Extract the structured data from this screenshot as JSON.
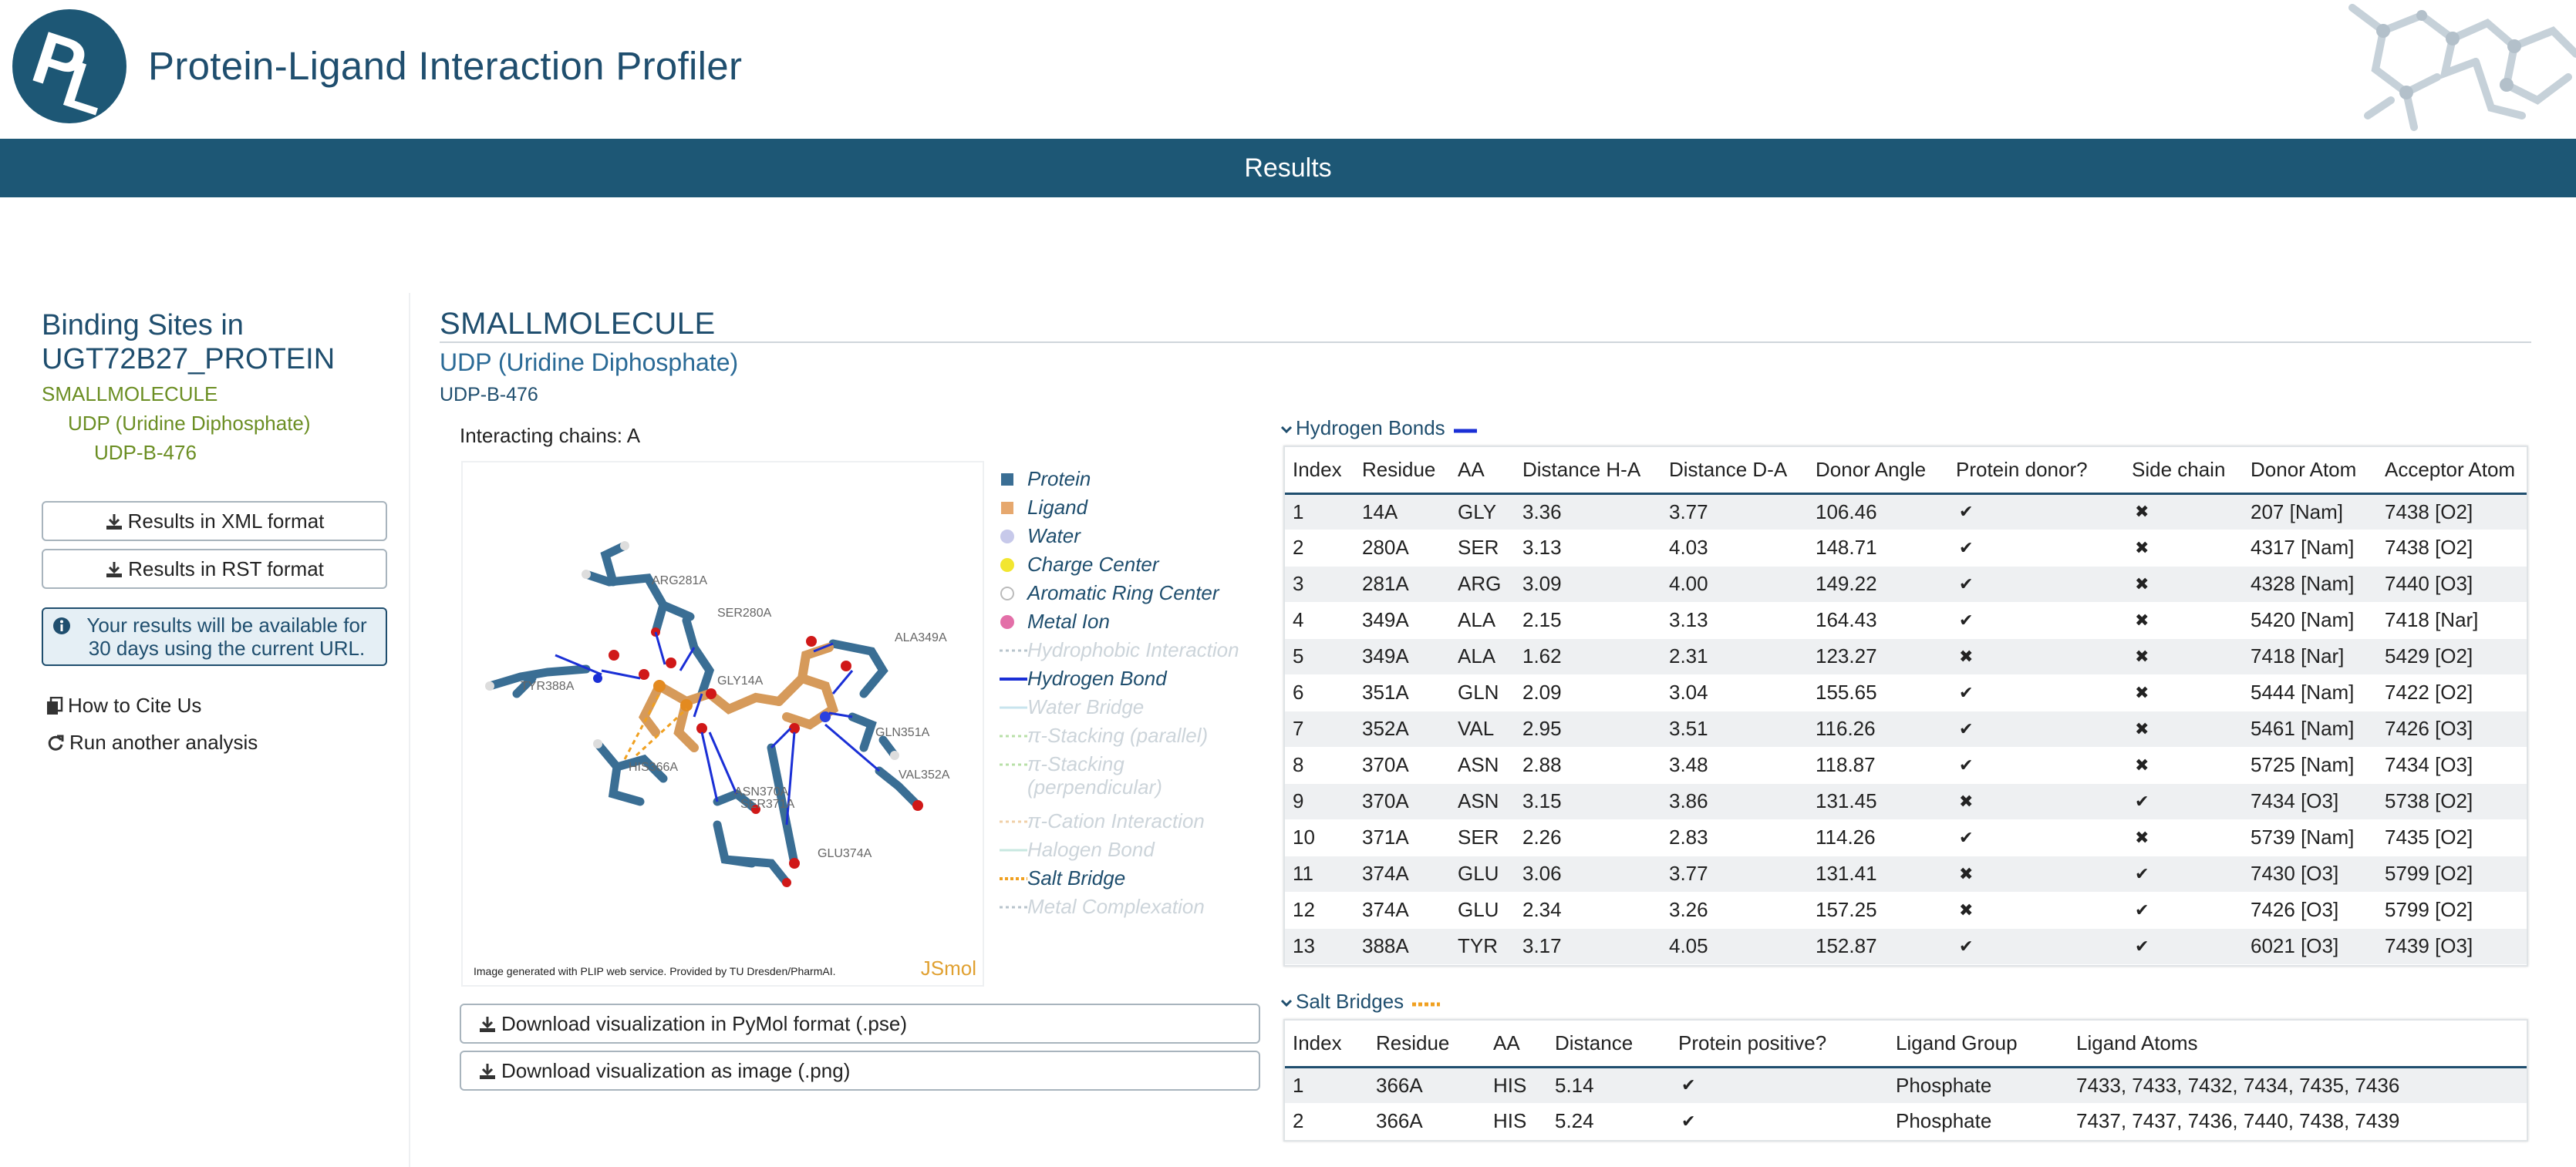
{
  "app": {
    "title": "Protein-Ligand Interaction Profiler",
    "section_bar": "Results"
  },
  "sidebar": {
    "title": "Binding Sites in UGT72B27_PROTEIN",
    "tree": [
      "SMALLMOLECULE",
      "UDP (Uridine Diphosphate)",
      "UDP-B-476"
    ],
    "buttons": {
      "xml": "Results in XML format",
      "rst": "Results in RST format"
    },
    "info": "Your results will be available for 30 days using the current URL.",
    "links": {
      "cite": "How to Cite Us",
      "run": "Run another analysis"
    }
  },
  "main": {
    "type": "SMALLMOLECULE",
    "ligand_name": "UDP (Uridine Diphosphate)",
    "site_id": "UDP-B-476",
    "chains": "Interacting chains: A",
    "viz_caption": "Image generated with PLIP web service. Provided by TU Dresden/PharmAI.",
    "viz_brand": "JSmol",
    "residue_labels": [
      "ARG281A",
      "SER280A",
      "TYR388A",
      "GLY14A",
      "ALA349A",
      "GLN351A",
      "VAL352A",
      "HIS366A",
      "ASN370A",
      "SER371A",
      "GLU374A"
    ],
    "legend": [
      {
        "label": "Protein",
        "icon": "square",
        "color": "#3a6e94",
        "active": true
      },
      {
        "label": "Ligand",
        "icon": "square",
        "color": "#e6a86e",
        "active": true
      },
      {
        "label": "Water",
        "icon": "circle",
        "color": "#c7c9ea",
        "active": true
      },
      {
        "label": "Charge Center",
        "icon": "circle",
        "color": "#f2e630",
        "active": true
      },
      {
        "label": "Aromatic Ring Center",
        "icon": "ring",
        "color": "#bbbbbb",
        "active": true
      },
      {
        "label": "Metal Ion",
        "icon": "circle",
        "color": "#e36fa8",
        "active": true
      },
      {
        "label": "Hydrophobic Interaction",
        "icon": "dash",
        "color": "#b8c4cc",
        "active": false
      },
      {
        "label": "Hydrogen Bond",
        "icon": "line",
        "color": "#1a2fd6",
        "active": true
      },
      {
        "label": "Water Bridge",
        "icon": "line",
        "color": "#c8e4ee",
        "active": false
      },
      {
        "label": "π-Stacking (parallel)",
        "icon": "dash",
        "color": "#b8e0a8",
        "active": false
      },
      {
        "label": "π-Stacking (perpendicular)",
        "icon": "dash",
        "color": "#b8e0a8",
        "active": false
      },
      {
        "label": "π-Cation Interaction",
        "icon": "dash",
        "color": "#f0d0a8",
        "active": false
      },
      {
        "label": "Halogen Bond",
        "icon": "line",
        "color": "#c8e8e0",
        "active": false
      },
      {
        "label": "Salt Bridge",
        "icon": "dash",
        "color": "#f0a020",
        "active": true
      },
      {
        "label": "Metal Complexation",
        "icon": "dash",
        "color": "#b8c4cc",
        "active": false
      }
    ],
    "downloads": {
      "pymol": "Download visualization in PyMol format (.pse)",
      "png": "Download visualization as image (.png)"
    }
  },
  "hbonds": {
    "title": "Hydrogen Bonds",
    "columns": [
      "Index",
      "Residue",
      "AA",
      "Distance H-A",
      "Distance D-A",
      "Donor Angle",
      "Protein donor?",
      "Side chain",
      "Donor Atom",
      "Acceptor Atom"
    ],
    "rows": [
      [
        "1",
        "14A",
        "GLY",
        "3.36",
        "3.77",
        "106.46",
        "✔",
        "✖",
        "207 [Nam]",
        "7438 [O2]"
      ],
      [
        "2",
        "280A",
        "SER",
        "3.13",
        "4.03",
        "148.71",
        "✔",
        "✖",
        "4317 [Nam]",
        "7438 [O2]"
      ],
      [
        "3",
        "281A",
        "ARG",
        "3.09",
        "4.00",
        "149.22",
        "✔",
        "✖",
        "4328 [Nam]",
        "7440 [O3]"
      ],
      [
        "4",
        "349A",
        "ALA",
        "2.15",
        "3.13",
        "164.43",
        "✔",
        "✖",
        "5420 [Nam]",
        "7418 [Nar]"
      ],
      [
        "5",
        "349A",
        "ALA",
        "1.62",
        "2.31",
        "123.27",
        "✖",
        "✖",
        "7418 [Nar]",
        "5429 [O2]"
      ],
      [
        "6",
        "351A",
        "GLN",
        "2.09",
        "3.04",
        "155.65",
        "✔",
        "✖",
        "5444 [Nam]",
        "7422 [O2]"
      ],
      [
        "7",
        "352A",
        "VAL",
        "2.95",
        "3.51",
        "116.26",
        "✔",
        "✖",
        "5461 [Nam]",
        "7426 [O3]"
      ],
      [
        "8",
        "370A",
        "ASN",
        "2.88",
        "3.48",
        "118.87",
        "✔",
        "✖",
        "5725 [Nam]",
        "7434 [O3]"
      ],
      [
        "9",
        "370A",
        "ASN",
        "3.15",
        "3.86",
        "131.45",
        "✖",
        "✔",
        "7434 [O3]",
        "5738 [O2]"
      ],
      [
        "10",
        "371A",
        "SER",
        "2.26",
        "2.83",
        "114.26",
        "✔",
        "✖",
        "5739 [Nam]",
        "7435 [O2]"
      ],
      [
        "11",
        "374A",
        "GLU",
        "3.06",
        "3.77",
        "131.41",
        "✖",
        "✔",
        "7430 [O3]",
        "5799 [O2]"
      ],
      [
        "12",
        "374A",
        "GLU",
        "2.34",
        "3.26",
        "157.25",
        "✖",
        "✔",
        "7426 [O3]",
        "5799 [O2]"
      ],
      [
        "13",
        "388A",
        "TYR",
        "3.17",
        "4.05",
        "152.87",
        "✔",
        "✔",
        "6021 [O3]",
        "7439 [O3]"
      ]
    ]
  },
  "saltbridges": {
    "title": "Salt Bridges",
    "columns": [
      "Index",
      "Residue",
      "AA",
      "Distance",
      "Protein positive?",
      "Ligand Group",
      "Ligand Atoms"
    ],
    "rows": [
      [
        "1",
        "366A",
        "HIS",
        "5.14",
        "✔",
        "Phosphate",
        "7433, 7433, 7432, 7434, 7435, 7436"
      ],
      [
        "2",
        "366A",
        "HIS",
        "5.24",
        "✔",
        "Phosphate",
        "7437, 7437, 7436, 7440, 7438, 7439"
      ]
    ]
  },
  "colors": {
    "brand": "#1d5775",
    "tree_link": "#6b8e23",
    "hbond": "#1a2fd6",
    "saltbridge": "#f0a020"
  }
}
